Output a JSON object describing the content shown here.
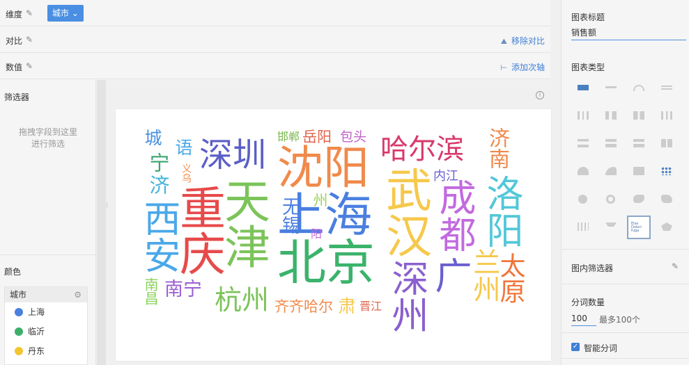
{
  "toolbar": {
    "dimension_label": "维度",
    "dimension_chip": "城市",
    "compare_label": "对比",
    "remove_compare": "移除对比",
    "value_label": "数值",
    "add_axis": "添加次轴"
  },
  "left_panel": {
    "filter_title": "筛选器",
    "filter_hint_1": "拖拽字段到这里",
    "filter_hint_2": "进行筛选",
    "color_title": "颜色",
    "color_field": "城市",
    "color_items": [
      {
        "label": "上海",
        "color": "#4a7fe0"
      },
      {
        "label": "临沂",
        "color": "#3cb06a"
      },
      {
        "label": "丹东",
        "color": "#f2c631"
      }
    ]
  },
  "right_panel": {
    "title_label": "图表标题",
    "title_value": "销售额",
    "type_label": "图表类型",
    "inchart_filter": "图内筛选器",
    "word_count_label": "分词数量",
    "word_count_value": "100",
    "word_count_max": "最多100个",
    "smart_seg": "智能分词"
  },
  "wordcloud": {
    "words": [
      {
        "t": "城",
        "c": "#4a90e2"
      },
      {
        "t": "语",
        "c": "#4aa8e8"
      },
      {
        "t": "深圳",
        "c": "#5b5fc7"
      },
      {
        "t": "邯郸",
        "c": "#79b84d"
      },
      {
        "t": "岳阳",
        "c": "#e0634a"
      },
      {
        "t": "包头",
        "c": "#c062c8"
      },
      {
        "t": "哈尔滨",
        "c": "#d8396c"
      },
      {
        "t": "济南",
        "c": "#f08a4b"
      },
      {
        "t": "沈阳",
        "c": "#f08a4b"
      },
      {
        "t": "宁",
        "c": "#3aa36e"
      },
      {
        "t": "济",
        "c": "#47b4d9"
      },
      {
        "t": "义乌",
        "c": "#f08a4b"
      },
      {
        "t": "内江",
        "c": "#6a5fcf"
      },
      {
        "t": "天津",
        "c": "#7cc45a"
      },
      {
        "t": "武汉",
        "c": "#f6c84b"
      },
      {
        "t": "成都",
        "c": "#c26adf"
      },
      {
        "t": "洛阳",
        "c": "#53c7d9"
      },
      {
        "t": "西安",
        "c": "#4aa8e8"
      },
      {
        "t": "重庆",
        "c": "#e74a4a"
      },
      {
        "t": "无锡",
        "c": "#4a7fe0"
      },
      {
        "t": "州",
        "c": "#9bd45a"
      },
      {
        "t": "上海",
        "c": "#4a7fe0"
      },
      {
        "t": "阳",
        "c": "#c26adf"
      },
      {
        "t": "北京",
        "c": "#3bb36b"
      },
      {
        "t": "深州",
        "c": "#8a5fcf"
      },
      {
        "t": "广",
        "c": "#6a5fcf"
      },
      {
        "t": "兰州",
        "c": "#f6c84b"
      },
      {
        "t": "太原",
        "c": "#f0763b"
      },
      {
        "t": "南昌",
        "c": "#8ad25a"
      },
      {
        "t": "南宁",
        "c": "#9b5fcf"
      },
      {
        "t": "杭州",
        "c": "#7cc45a"
      },
      {
        "t": "齐齐哈尔",
        "c": "#f08a4b"
      },
      {
        "t": "肃",
        "c": "#f6c84b"
      },
      {
        "t": "晋江",
        "c": "#e0634a"
      }
    ]
  }
}
